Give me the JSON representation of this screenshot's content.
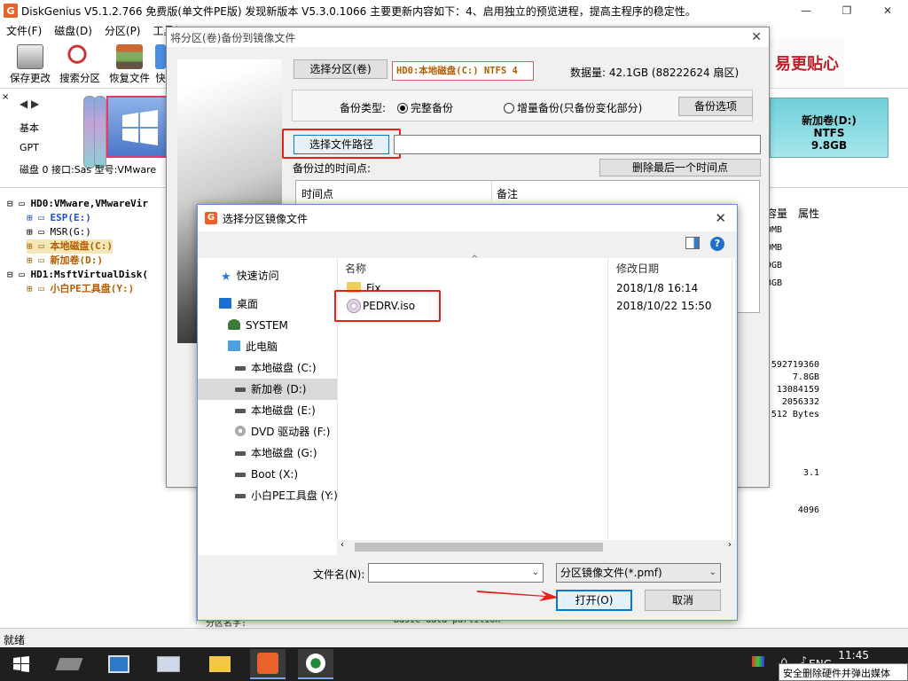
{
  "app": {
    "title": "DiskGenius V5.1.2.766 免费版(单文件PE版)    发现新版本 V5.3.0.1066 主要更新内容如下：4、启用独立的预览进程，提高主程序的稳定性。",
    "icon_letter": "G",
    "menu": [
      "文件(F)",
      "磁盘(D)",
      "分区(P)",
      "工具("
    ],
    "toolbar": [
      "保存更改",
      "搜索分区",
      "恢复文件",
      "快"
    ],
    "banner_text": "易更贴心",
    "left_info": {
      "type": "基本",
      "table": "GPT"
    },
    "disk_line": "磁盘 0 接口:Sas   型号:VMware",
    "partition_d": {
      "name": "新加卷(D:)",
      "fs": "NTFS",
      "size": "9.8GB"
    },
    "status": "就绪"
  },
  "tree": [
    "HD0:VMware,VMwareVir",
    "ESP(E:)",
    "MSR(G:)",
    "本地磁盘(C:)",
    "新加卷(D:)",
    "HD1:MsftVirtualDisk(",
    "小白PE工具盘(Y:)"
  ],
  "right_pane": {
    "headers": [
      "容量",
      "属性"
    ],
    "cap_values": [
      "0MB",
      "0MB",
      "9GB",
      "8GB"
    ],
    "details": [
      "592719360",
      "7.8GB",
      "13084159",
      "2056332",
      "512 Bytes",
      "3.1",
      "4096"
    ]
  },
  "bottom_text": {
    "label": "分区名字:",
    "value": "Basic data partition"
  },
  "backup_dialog": {
    "title": "将分区(卷)备份到镜像文件",
    "select_partition_btn": "选择分区(卷)",
    "partition_label": "HD0:本地磁盘(C:) NTFS 4",
    "data_size": "数据量: 42.1GB (88222624 扇区)",
    "backup_type_label": "备份类型:",
    "full_backup": "完整备份",
    "incremental_backup": "增量备份(只备份变化部分)",
    "backup_options_btn": "备份选项",
    "select_path_btn": "选择文件路径",
    "path_value": "",
    "timepoints_label": "备份过的时间点:",
    "delete_last_btn": "删除最后一个时间点",
    "columns": [
      "时间点",
      "备注"
    ]
  },
  "open_dialog": {
    "title": "选择分区镜像文件",
    "nav": [
      {
        "label": "快速访问",
        "icon": "star-icon"
      },
      {
        "label": "桌面",
        "icon": "desktop-icon"
      },
      {
        "label": "SYSTEM",
        "icon": "user-icon"
      },
      {
        "label": "此电脑",
        "icon": "computer-icon"
      },
      {
        "label": "本地磁盘 (C:)",
        "icon": "drive-icon"
      },
      {
        "label": "新加卷 (D:)",
        "icon": "drive-icon"
      },
      {
        "label": "本地磁盘 (E:)",
        "icon": "drive-icon"
      },
      {
        "label": "DVD 驱动器 (F:)",
        "icon": "dvd-icon"
      },
      {
        "label": "本地磁盘 (G:)",
        "icon": "drive-icon"
      },
      {
        "label": "Boot (X:)",
        "icon": "drive-icon"
      },
      {
        "label": "小白PE工具盘 (Y:)",
        "icon": "drive-icon"
      }
    ],
    "columns": {
      "name": "名称",
      "date": "修改日期"
    },
    "files": [
      {
        "name": "Fix",
        "date": "2018/1/8 16:14",
        "icon": "folder-icon"
      },
      {
        "name": "PEDRV.iso",
        "date": "2018/10/22 15:50",
        "icon": "disc-image-icon"
      }
    ],
    "filename_label": "文件名(N):",
    "filename_value": "",
    "filter": "分区镜像文件(*.pmf)",
    "open_btn": "打开(O)",
    "cancel_btn": "取消"
  },
  "taskbar": {
    "clock": "11:45",
    "lang": "ENG",
    "tooltip": "安全删除硬件并弹出媒体"
  }
}
